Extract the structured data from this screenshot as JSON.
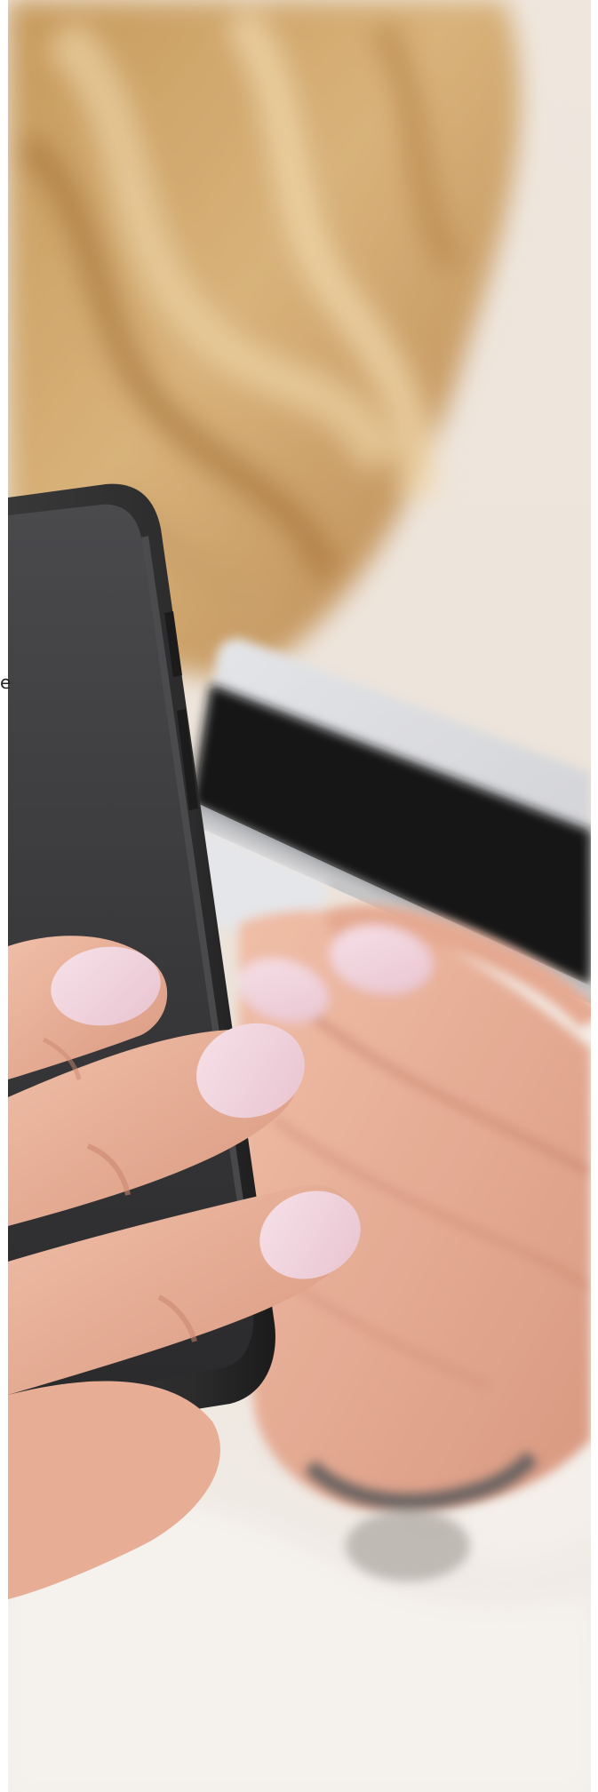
{
  "photo": {
    "subject": "hands-holding-phone-and-credit-card",
    "palette": {
      "hair": "#c79a5d",
      "hair_dark": "#9f7440",
      "hair_light": "#e7c998",
      "skin": "#eab49d",
      "skin_shadow": "#c98570",
      "nail": "#f1d3dd",
      "phone": "#2f2f2f",
      "phone_screen": "#3f3f42",
      "card_stripe": "#171717",
      "card_body": "#e1e2e6",
      "background": "#eee7df",
      "sleeve": "#f2efeb"
    }
  },
  "edge_glyph": "e"
}
